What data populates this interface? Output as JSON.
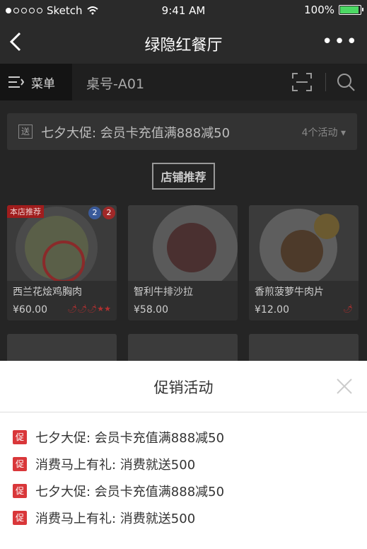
{
  "status": {
    "carrier": "Sketch",
    "time": "9:41 AM",
    "battery": "100%"
  },
  "nav": {
    "title": "绿隐红餐厅",
    "back_icon": "chevron-left-icon",
    "more_icon": "more-icon",
    "more_text": "•••"
  },
  "tabs": {
    "menu_label": "菜单",
    "table_no": "桌号-A01"
  },
  "promo_bar": {
    "tag": "送",
    "text": "七夕大促: 会员卡充值满888减50",
    "count": "4个活动 ▾"
  },
  "section": {
    "title": "店铺推荐"
  },
  "dishes": [
    {
      "name": "西兰花烩鸡胸肉",
      "price": "¥60.00",
      "badge": "本店推荐",
      "counts": [
        "2",
        "2"
      ],
      "spice": "🌶🌶🌶★★"
    },
    {
      "name": "智利牛排沙拉",
      "price": "¥58.00"
    },
    {
      "name": "香煎菠萝牛肉片",
      "price": "¥12.00",
      "spice": "🌶"
    }
  ],
  "sheet": {
    "title": "促销活动",
    "items": [
      {
        "badge": "促",
        "text": "七夕大促: 会员卡充值满888减50"
      },
      {
        "badge": "促",
        "text": "消费马上有礼: 消费就送500"
      },
      {
        "badge": "促",
        "text": "七夕大促: 会员卡充值满888减50"
      },
      {
        "badge": "促",
        "text": "消费马上有礼: 消费就送500"
      }
    ]
  },
  "colors": {
    "accent": "#d9373a",
    "overlay": "#252525",
    "battery": "#4cd964"
  }
}
